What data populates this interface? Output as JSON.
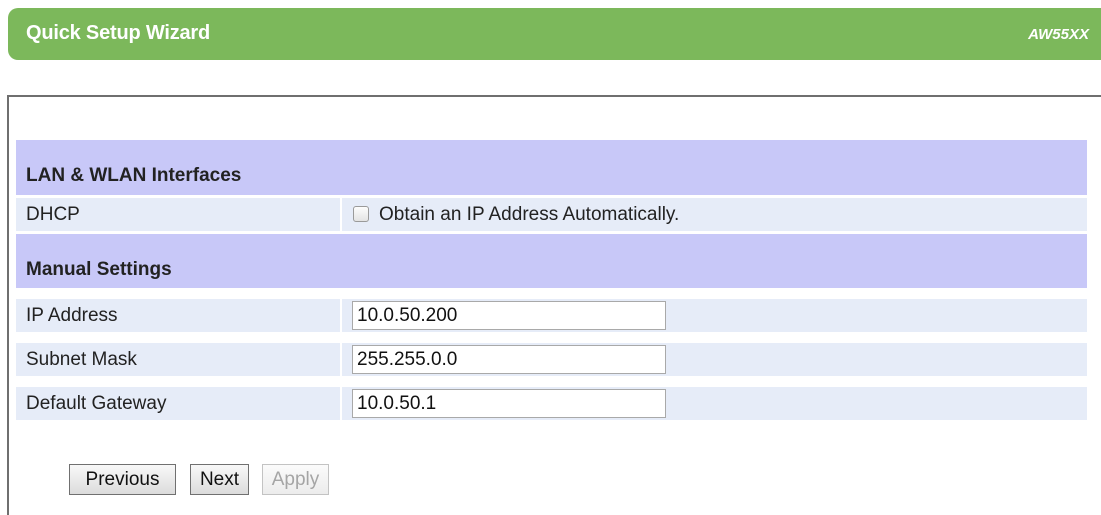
{
  "header": {
    "title": "Quick Setup Wizard",
    "model": "AW55XX",
    "color": "#7cb85b"
  },
  "sections": {
    "lan_wlan": {
      "title": "LAN & WLAN Interfaces"
    },
    "manual": {
      "title": "Manual Settings"
    }
  },
  "dhcp": {
    "label": "DHCP",
    "checkbox_label": "Obtain an IP Address Automatically.",
    "checked": false
  },
  "fields": {
    "ip_address": {
      "label": "IP Address",
      "value": "10.0.50.200"
    },
    "subnet_mask": {
      "label": "Subnet Mask",
      "value": "255.255.0.0"
    },
    "default_gateway": {
      "label": "Default Gateway",
      "value": "10.0.50.1"
    }
  },
  "buttons": {
    "previous": "Previous",
    "next": "Next",
    "apply": "Apply"
  },
  "colors": {
    "section_header_bg": "#c8c8f8",
    "field_row_bg": "#e6ecf8"
  }
}
